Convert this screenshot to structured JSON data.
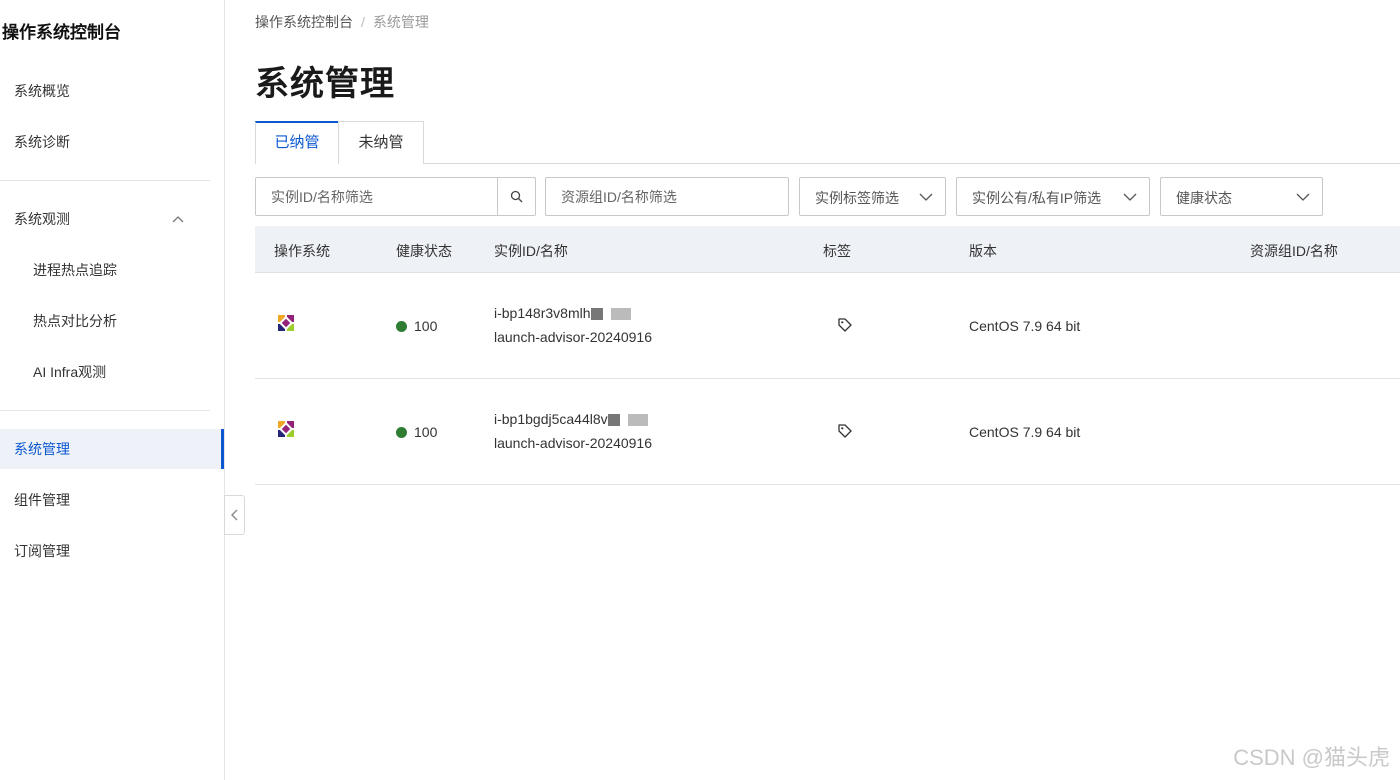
{
  "app": {
    "title": "操作系统控制台"
  },
  "sidebar": {
    "items": [
      {
        "label": "系统概览"
      },
      {
        "label": "系统诊断"
      },
      {
        "label": "系统观测"
      },
      {
        "label": "进程热点追踪"
      },
      {
        "label": "热点对比分析"
      },
      {
        "label": "AI Infra观测"
      },
      {
        "label": "系统管理"
      },
      {
        "label": "组件管理"
      },
      {
        "label": "订阅管理"
      }
    ]
  },
  "breadcrumb": {
    "root": "操作系统控制台",
    "separator": "/",
    "current": "系统管理"
  },
  "page": {
    "title": "系统管理"
  },
  "tabs": [
    {
      "label": "已纳管"
    },
    {
      "label": "未纳管"
    }
  ],
  "filters": {
    "instance_search": {
      "placeholder": "实例ID/名称筛选"
    },
    "resource_group": {
      "placeholder": "资源组ID/名称筛选"
    },
    "tag_select": {
      "label": "实例标签筛选"
    },
    "ip_select": {
      "label": "实例公有/私有IP筛选"
    },
    "health_select": {
      "label": "健康状态"
    }
  },
  "table": {
    "columns": [
      "操作系统",
      "健康状态",
      "实例ID/名称",
      "标签",
      "版本",
      "资源组ID/名称"
    ],
    "rows": [
      {
        "os_icon": "centos-icon",
        "health": "100",
        "instance_id": "i-bp148r3v8mlh",
        "instance_name": "launch-advisor-20240916",
        "version": "CentOS  7.9 64 bit",
        "resource_group": ""
      },
      {
        "os_icon": "centos-icon",
        "health": "100",
        "instance_id": "i-bp1bgdj5ca44l8v",
        "instance_name": "launch-advisor-20240916",
        "version": "CentOS  7.9 64 bit",
        "resource_group": ""
      }
    ]
  },
  "colors": {
    "accent": "#0b57d0",
    "healthy": "#2e7d32",
    "header_bg": "#eef1f6"
  },
  "watermark": "CSDN @猫头虎"
}
